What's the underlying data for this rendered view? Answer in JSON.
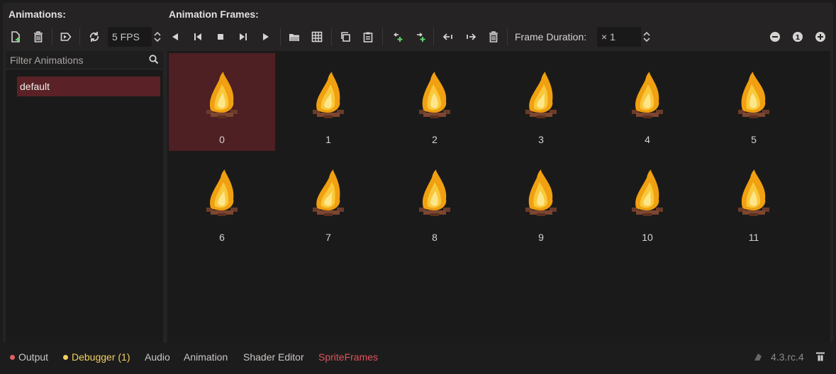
{
  "headings": {
    "animations": "Animations:",
    "frames": "Animation Frames:"
  },
  "toolbar": {
    "fps_value": "5 FPS",
    "frame_duration_label": "Frame Duration:",
    "frame_duration_value": "× 1",
    "zoom_reset_label": "1"
  },
  "filter": {
    "placeholder": "Filter Animations"
  },
  "animations": [
    "default"
  ],
  "frames": [
    "0",
    "1",
    "2",
    "3",
    "4",
    "5",
    "6",
    "7",
    "8",
    "9",
    "10",
    "11"
  ],
  "selected_frame": "0",
  "bottom_tabs": {
    "output": "Output",
    "debugger": "Debugger (1)",
    "audio": "Audio",
    "animation": "Animation",
    "shader_editor": "Shader Editor",
    "sprite_frames": "SpriteFrames"
  },
  "version": "4.3.rc.4",
  "colors": {
    "accent_selected": "#5a2226",
    "output_dot": "#e06060",
    "debugger": "#f2cf60",
    "sprite_frames_active": "#e0525a",
    "add_green": "#5fd56f"
  }
}
